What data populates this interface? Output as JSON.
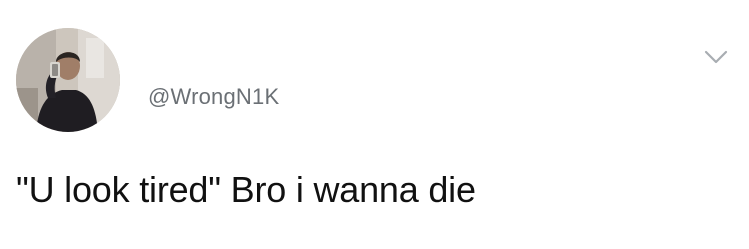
{
  "tweet": {
    "author": {
      "handle": "@WrongN1K",
      "avatar_icon": "profile-photo"
    },
    "more_icon": "chevron-down-icon",
    "text": "\"U look tired\" Bro i wanna die"
  },
  "colors": {
    "background": "#ffffff",
    "handle": "#6b7075",
    "text": "#111111",
    "icon": "#a8adb2"
  }
}
